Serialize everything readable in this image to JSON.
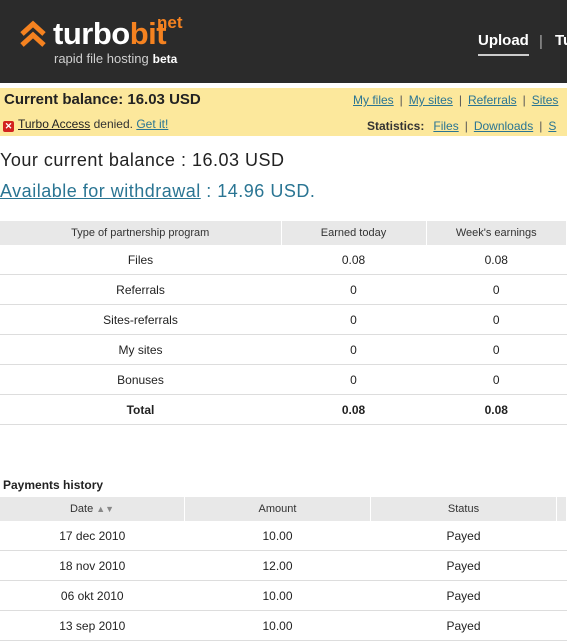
{
  "header": {
    "logo_white": "turbo",
    "logo_orange": "bit",
    "logo_net": "net",
    "tagline": "rapid file hosting",
    "beta": "beta",
    "nav_upload": "Upload",
    "nav_sep": "|",
    "nav_next_partial": "Tu"
  },
  "bar": {
    "balance_label": "Current balance: 16.03 USD",
    "links": [
      "My files",
      "My sites",
      "Referrals",
      "Sites"
    ],
    "access_service": "Turbo Access",
    "access_status": "denied.",
    "access_link": "Get it!",
    "stats_label": "Statistics:",
    "stats_links": [
      "Files",
      "Downloads",
      "S"
    ]
  },
  "balance": {
    "current": "Your current balance : 16.03 USD",
    "withdraw_link": "Available for withdrawal",
    "withdraw_value": " : 14.96 USD."
  },
  "partnership": {
    "headers": [
      "Type of partnership program",
      "Earned today",
      "Week's earnings"
    ],
    "rows": [
      [
        "Files",
        "0.08",
        "0.08"
      ],
      [
        "Referrals",
        "0",
        "0"
      ],
      [
        "Sites-referrals",
        "0",
        "0"
      ],
      [
        "My sites",
        "0",
        "0"
      ],
      [
        "Bonuses",
        "0",
        "0"
      ]
    ],
    "total": [
      "Total",
      "0.08",
      "0.08"
    ]
  },
  "payments": {
    "title": "Payments history",
    "headers": [
      "Date",
      "Amount",
      "Status"
    ],
    "rows": [
      [
        "17 dec 2010",
        "10.00",
        "Payed"
      ],
      [
        "18 nov 2010",
        "12.00",
        "Payed"
      ],
      [
        "06 okt 2010",
        "10.00",
        "Payed"
      ],
      [
        "13 sep 2010",
        "10.00",
        "Payed"
      ]
    ]
  }
}
